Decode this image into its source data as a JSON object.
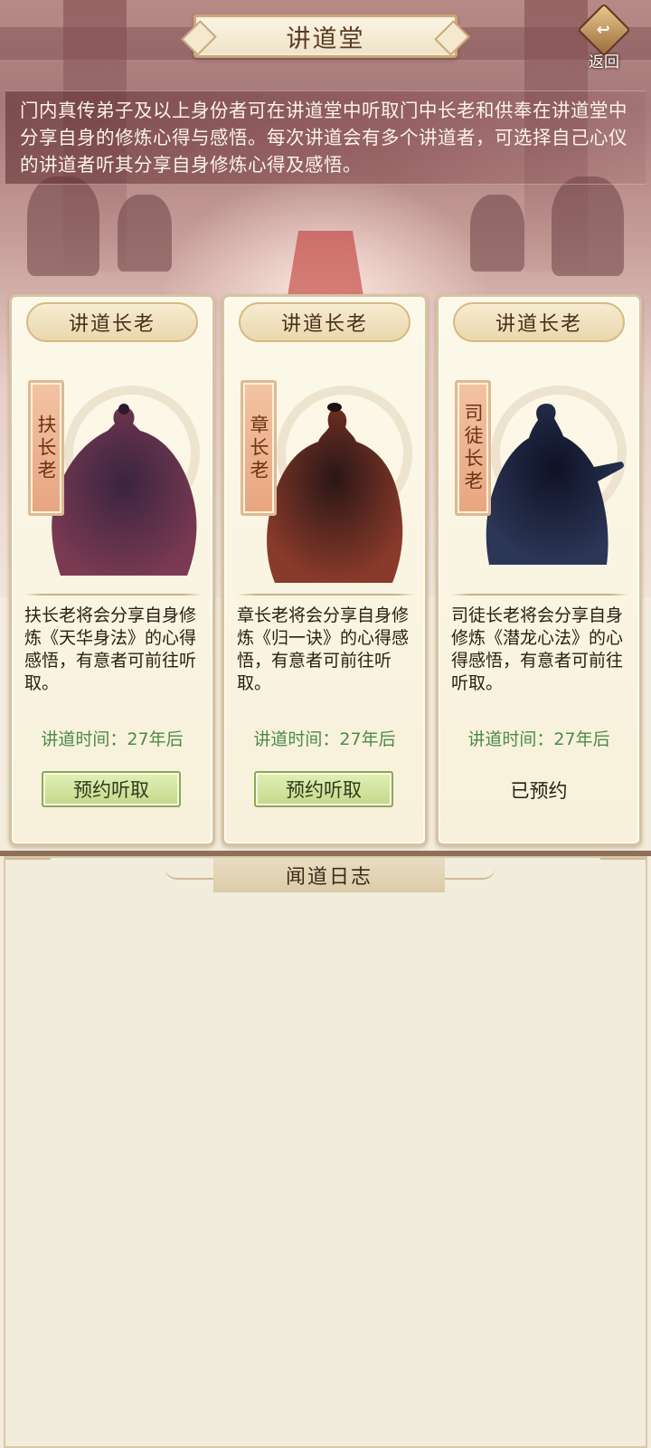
{
  "header": {
    "title": "讲道堂",
    "back_label": "返回"
  },
  "intro": {
    "text": "门内真传弟子及以上身份者可在讲道堂中听取门中长老和供奉在讲道堂中分享自身的修炼心得与感悟。每次讲道会有多个讲道者，可选择自己心仪的讲道者听其分享自身修炼心得及感悟。"
  },
  "cards": [
    {
      "header": "讲道长老",
      "name": "扶长老",
      "desc": "扶长老将会分享自身修炼《天华身法》的心得感悟，有意者可前往听取。",
      "time": "讲道时间：27年后",
      "action": "预约听取",
      "accent": "#7b3a52"
    },
    {
      "header": "讲道长老",
      "name": "章长老",
      "desc": "章长老将会分享自身修炼《归一诀》的心得感悟，有意者可前往听取。",
      "time": "讲道时间：27年后",
      "action": "预约听取",
      "accent": "#6a2a2a"
    },
    {
      "header": "讲道长老",
      "name": "司徒长老",
      "desc": "司徒长老将会分享自身修炼《潜龙心法》的心得感悟，有意者可前往听取。",
      "time": "讲道时间：27年后",
      "status": "已预约",
      "accent": "#2c3656"
    }
  ],
  "log": {
    "title": "闻道日志"
  },
  "colors": {
    "button_green": "#c2d98a",
    "time_green": "#4d8a48",
    "card_bg": "#fdf9ea"
  }
}
